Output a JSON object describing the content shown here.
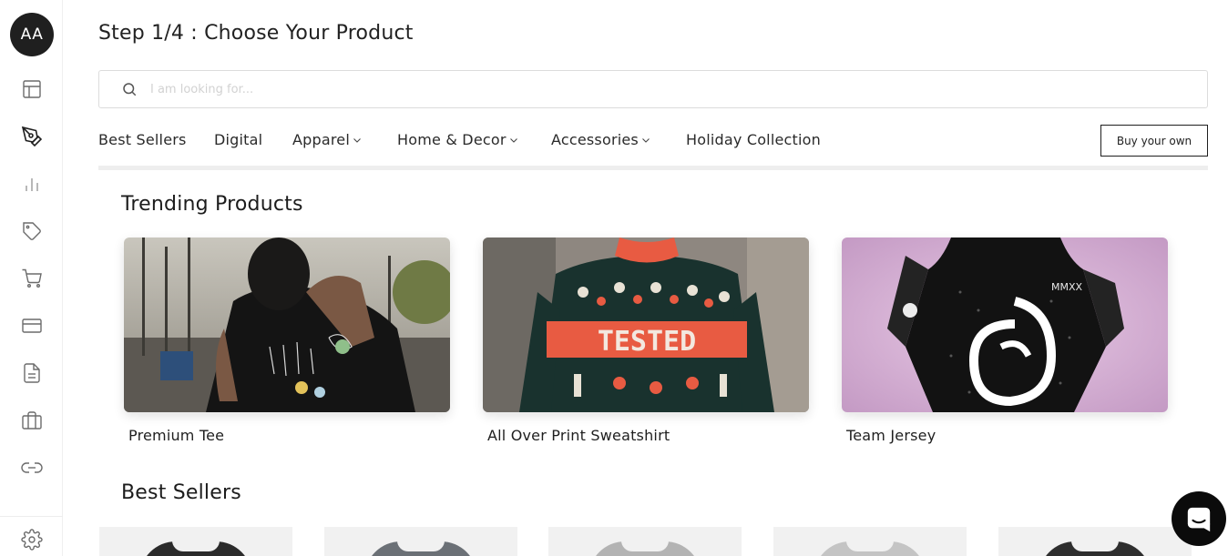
{
  "user": {
    "initials": "AA"
  },
  "sidebar": {
    "icons": [
      "layout-icon",
      "pen-tool-icon",
      "bar-chart-icon",
      "tag-icon",
      "cart-icon",
      "credit-card-icon",
      "document-icon",
      "briefcase-icon",
      "link-icon",
      "gear-icon"
    ]
  },
  "header": {
    "title": "Step 1/4 : Choose Your Product"
  },
  "search": {
    "placeholder": "I am looking for...",
    "value": ""
  },
  "nav": {
    "items": [
      {
        "label": "Best Sellers",
        "has_dropdown": false
      },
      {
        "label": "Digital",
        "has_dropdown": false
      },
      {
        "label": "Apparel",
        "has_dropdown": true
      },
      {
        "label": "Home & Decor",
        "has_dropdown": true
      },
      {
        "label": "Accessories",
        "has_dropdown": true
      },
      {
        "label": "Holiday Collection",
        "has_dropdown": false
      }
    ],
    "buy_button": "Buy your own"
  },
  "trending": {
    "title": "Trending Products",
    "products": [
      {
        "name": "Premium Tee"
      },
      {
        "name": "All Over Print Sweatshirt",
        "image_text": "TESTED"
      },
      {
        "name": "Team Jersey",
        "image_text": "MMXX"
      }
    ]
  },
  "best_sellers": {
    "title": "Best Sellers",
    "shirt_colors": [
      "#2b2b2b",
      "#6b7076",
      "#b3b3b3",
      "#c4c4c4",
      "#2e2e2e"
    ]
  },
  "colors": {
    "accent": "#1f1f1f",
    "border": "#dcdcdc",
    "chat_button": "#0b0b0b"
  }
}
